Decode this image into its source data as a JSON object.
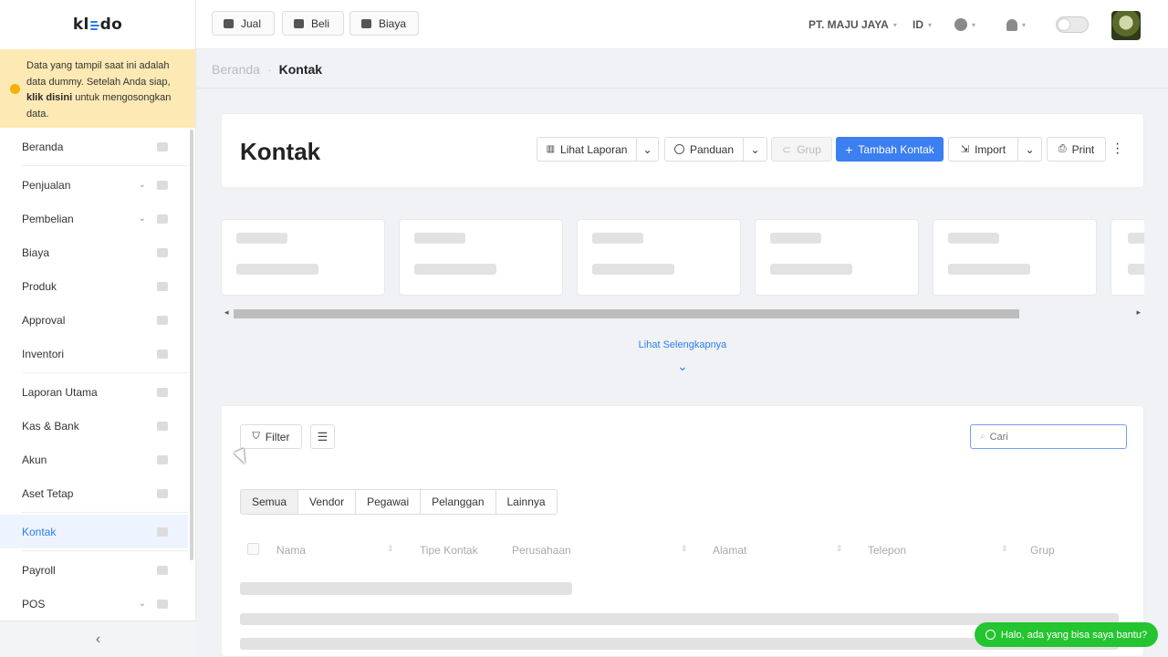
{
  "logo": {
    "left": "kl",
    "right": "do"
  },
  "notice": {
    "text_before": "Data yang tampil saat ini adalah data dummy. Setelah Anda siap, ",
    "link": "klik disini",
    "text_after": " untuk mengosongkan data."
  },
  "sidebar": {
    "items": [
      {
        "label": "Beranda",
        "icon": "home-icon"
      },
      {
        "label": "Penjualan",
        "icon": "basket-icon",
        "expandable": true
      },
      {
        "label": "Pembelian",
        "icon": "bag-icon",
        "expandable": true
      },
      {
        "label": "Biaya",
        "icon": "card-icon"
      },
      {
        "label": "Produk",
        "icon": "box-icon"
      },
      {
        "label": "Approval",
        "icon": "check-icon"
      },
      {
        "label": "Inventori",
        "icon": "warehouse-icon"
      },
      {
        "label": "Laporan Utama",
        "icon": "chart-icon"
      },
      {
        "label": "Kas & Bank",
        "icon": "dollar-icon"
      },
      {
        "label": "Akun",
        "icon": "account-icon"
      },
      {
        "label": "Aset Tetap",
        "icon": "building-icon"
      },
      {
        "label": "Kontak",
        "icon": "contact-card-icon",
        "active": true
      },
      {
        "label": "Payroll",
        "icon": "payroll-icon"
      },
      {
        "label": "POS",
        "icon": "pos-icon",
        "expandable": true
      }
    ],
    "collapse_icon": "‹"
  },
  "topbar": {
    "jual": "Jual",
    "beli": "Beli",
    "biaya": "Biaya",
    "company": "PT. MAJU JAYA",
    "lang": "ID"
  },
  "breadcrumb": {
    "home": "Beranda",
    "current": "Kontak"
  },
  "header": {
    "title": "Kontak",
    "lihat_laporan": "Lihat Laporan",
    "panduan": "Panduan",
    "grup": "Grup",
    "tambah_kontak": "Tambah Kontak",
    "import": "Import",
    "print": "Print"
  },
  "see_more": "Lihat Selengkapnya",
  "table": {
    "filter": "Filter",
    "search_placeholder": "Cari",
    "tabs": [
      "Semua",
      "Vendor",
      "Pegawai",
      "Pelanggan",
      "Lainnya"
    ],
    "columns": [
      "Nama",
      "Tipe Kontak",
      "Perusahaan",
      "Alamat",
      "Telepon",
      "Grup"
    ]
  },
  "whatsapp": "Halo, ada yang bisa saya bantu?",
  "colors": {
    "primary": "#3b7ff1",
    "notice": "#fde9b4",
    "whatsapp": "#25c431"
  }
}
